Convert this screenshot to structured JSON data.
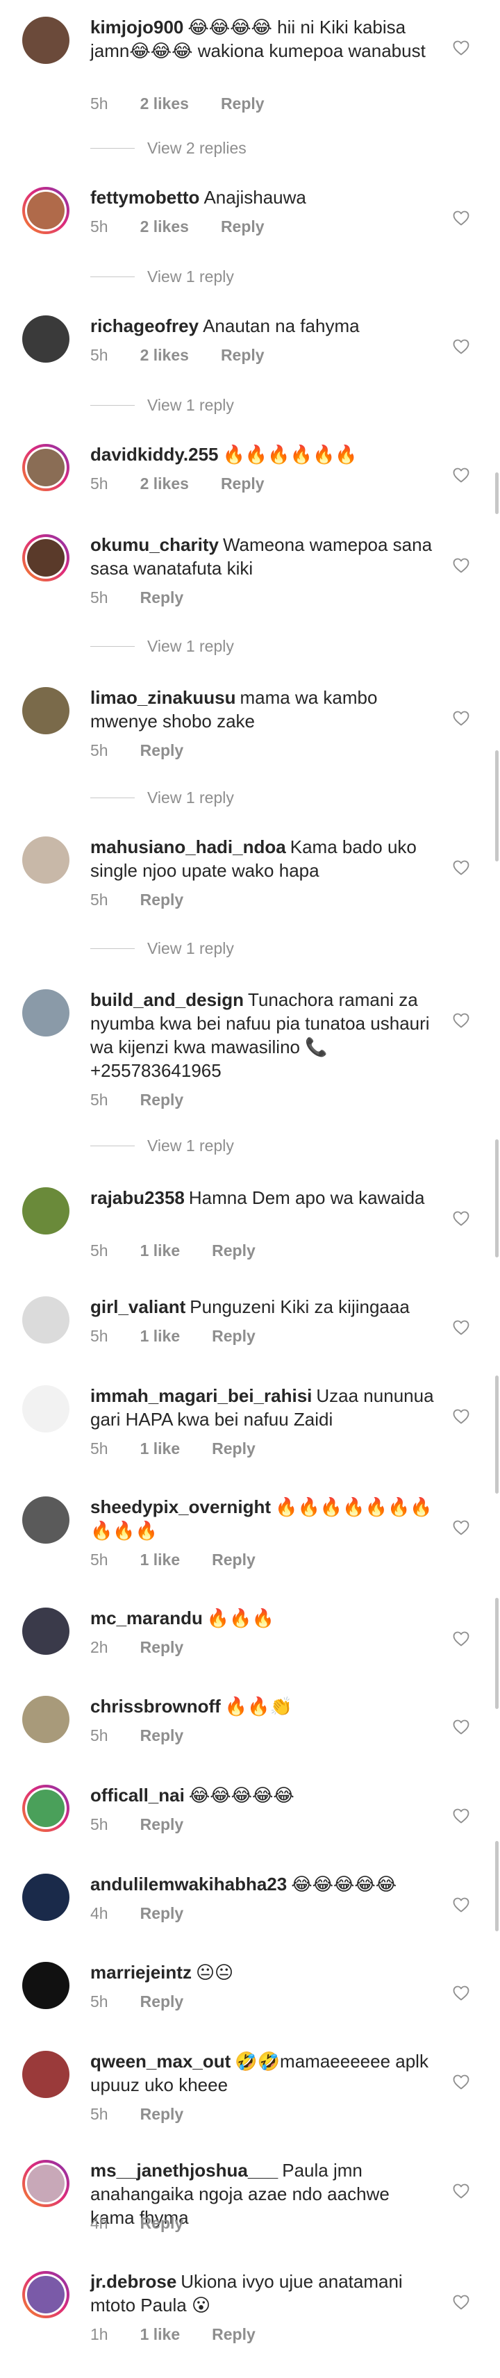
{
  "comments": [
    {
      "username": "kimjojo900",
      "text": "😂😂😂😂 hii ni Kiki kabisa jamn😂😂😂 wakiona kumepoa wanabust",
      "time": "5h",
      "likes": "2 likes",
      "reply": "Reply",
      "view_replies": "View 2 replies",
      "avatar_color": "#6b4a3a",
      "ring": false
    },
    {
      "username": "fettymobetto",
      "text": "Anajishauwa",
      "time": "5h",
      "likes": "2 likes",
      "reply": "Reply",
      "view_replies": "View 1 reply",
      "avatar_color": "#b06a4a",
      "ring": true
    },
    {
      "username": "richageofrey",
      "text": "Anautan na fahyma",
      "time": "5h",
      "likes": "2 likes",
      "reply": "Reply",
      "view_replies": "View 1 reply",
      "avatar_color": "#3a3a3a",
      "ring": false
    },
    {
      "username": "davidkiddy.255",
      "text": "🔥🔥🔥🔥🔥🔥",
      "time": "5h",
      "likes": "2 likes",
      "reply": "Reply",
      "view_replies": "",
      "avatar_color": "#8a6d55",
      "ring": true
    },
    {
      "username": "okumu_charity",
      "text": "Wameona wamepoa sana sasa wanatafuta kiki",
      "time": "5h",
      "likes": "",
      "reply": "Reply",
      "view_replies": "View 1 reply",
      "avatar_color": "#5a3a2a",
      "ring": true
    },
    {
      "username": "limao_zinakuusu",
      "text": "mama wa kambo mwenye shobo zake",
      "time": "5h",
      "likes": "",
      "reply": "Reply",
      "view_replies": "View 1 reply",
      "avatar_color": "#7a6a4a",
      "ring": false
    },
    {
      "username": "mahusiano_hadi_ndoa",
      "text": "Kama bado uko single njoo upate wako hapa",
      "time": "5h",
      "likes": "",
      "reply": "Reply",
      "view_replies": "View 1 reply",
      "avatar_color": "#c8b8a8",
      "ring": false
    },
    {
      "username": "build_and_design",
      "text": "Tunachora ramani za nyumba kwa bei nafuu pia tunatoa ushauri wa kijenzi kwa mawasilino 📞 +255783641965",
      "time": "5h",
      "likes": "",
      "reply": "Reply",
      "view_replies": "View 1 reply",
      "avatar_color": "#8a9aa8",
      "ring": false
    },
    {
      "username": "rajabu2358",
      "text": "Hamna Dem apo wa kawaida",
      "time": "5h",
      "likes": "1 like",
      "reply": "Reply",
      "view_replies": "",
      "avatar_color": "#6a8a3a",
      "ring": false
    },
    {
      "username": "girl_valiant",
      "text": "Punguzeni Kiki za kijingaaa",
      "time": "5h",
      "likes": "1 like",
      "reply": "Reply",
      "view_replies": "",
      "avatar_color": "#dbdbdb",
      "ring": false
    },
    {
      "username": "immah_magari_bei_rahisi",
      "text": "Uzaa nununua gari HAPA kwa bei nafuu Zaidi",
      "time": "5h",
      "likes": "1 like",
      "reply": "Reply",
      "view_replies": "",
      "avatar_color": "#f2f2f2",
      "ring": false
    },
    {
      "username": "sheedypix_overnight",
      "text": "🔥🔥🔥🔥🔥🔥🔥🔥🔥🔥",
      "time": "5h",
      "likes": "1 like",
      "reply": "Reply",
      "view_replies": "",
      "avatar_color": "#5a5a5a",
      "ring": false
    },
    {
      "username": "mc_marandu",
      "text": "🔥🔥🔥",
      "time": "2h",
      "likes": "",
      "reply": "Reply",
      "view_replies": "",
      "avatar_color": "#3a3a4a",
      "ring": false
    },
    {
      "username": "chrissbrownoff",
      "text": "🔥🔥👏",
      "time": "5h",
      "likes": "",
      "reply": "Reply",
      "view_replies": "",
      "avatar_color": "#a89a7a",
      "ring": false
    },
    {
      "username": "officall_nai",
      "text": "😂😂😂😂😂",
      "time": "5h",
      "likes": "",
      "reply": "Reply",
      "view_replies": "",
      "avatar_color": "#4aa05a",
      "ring": true
    },
    {
      "username": "andulilemwakihabha23",
      "text": "😂😂😂😂😂",
      "time": "4h",
      "likes": "",
      "reply": "Reply",
      "view_replies": "",
      "avatar_color": "#1a2a4a",
      "ring": false
    },
    {
      "username": "marriejeintz",
      "text": "😐😐",
      "time": "5h",
      "likes": "",
      "reply": "Reply",
      "view_replies": "",
      "avatar_color": "#111111",
      "ring": false
    },
    {
      "username": "qween_max_out",
      "text": "🤣🤣mamaeeeeee aplk upuuz uko kheee",
      "time": "5h",
      "likes": "",
      "reply": "Reply",
      "view_replies": "",
      "avatar_color": "#9a3a3a",
      "ring": false
    },
    {
      "username": "ms__janethjoshua___",
      "text": "Paula jmn anahangaika ngoja azae ndo aachwe kama fhyma",
      "time": "4h",
      "likes": "",
      "reply": "Reply",
      "view_replies": "",
      "avatar_color": "#c8a8b8",
      "ring": true
    },
    {
      "username": "jr.debrose",
      "text": "Ukiona ivyo ujue anatamani mtoto Paula 😮",
      "time": "1h",
      "likes": "1 like",
      "reply": "Reply",
      "view_replies": "",
      "avatar_color": "#7a5aa8",
      "ring": true
    }
  ],
  "colors": {
    "text": "#262626",
    "meta": "#8e8e8e",
    "divider": "#c7c7c7",
    "ring_start": "#f58529",
    "ring_mid": "#dd2a7b",
    "ring_end": "#8134af"
  }
}
